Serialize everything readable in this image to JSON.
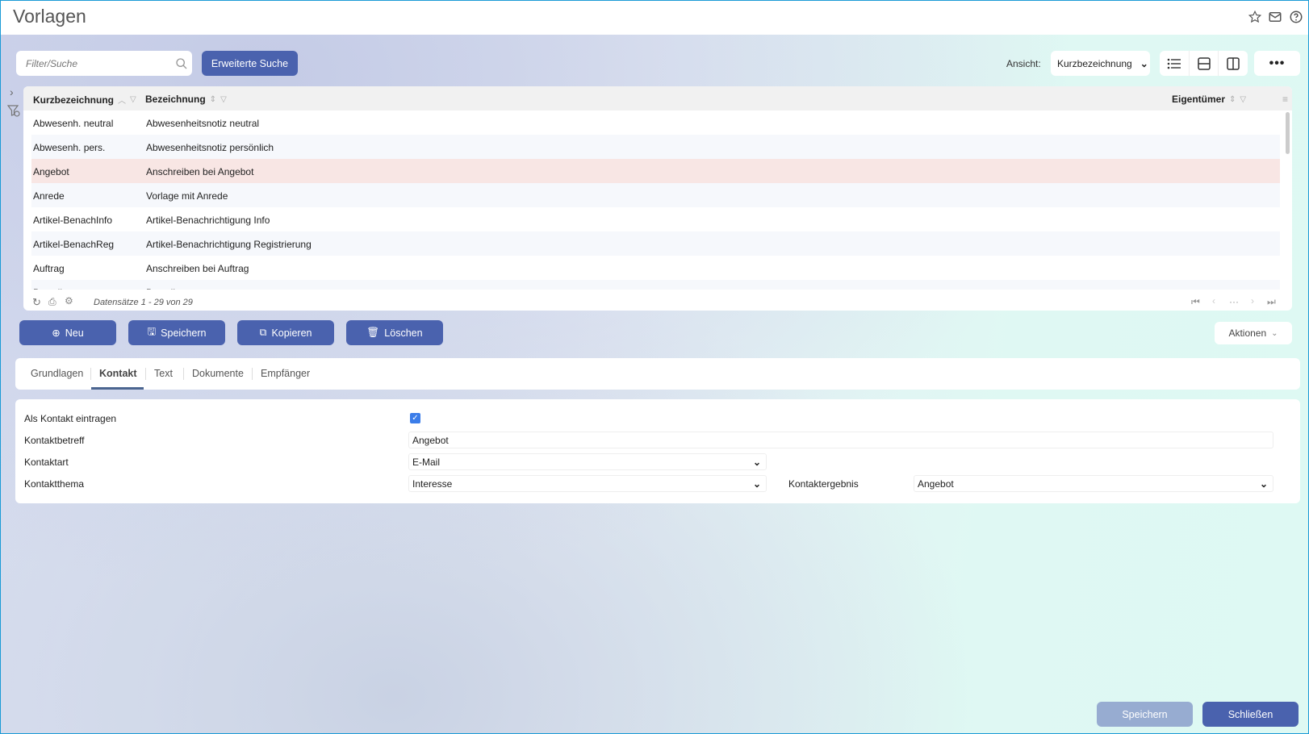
{
  "title": "Vorlagen",
  "header_icons": [
    "star-icon",
    "mail-icon",
    "help-icon"
  ],
  "toolbar": {
    "search_placeholder": "Filter/Suche",
    "advanced_search": "Erweiterte Suche",
    "view_label": "Ansicht:",
    "view_value": "Kurzbezeichnung",
    "more": "•••"
  },
  "grid": {
    "columns": [
      "Kurzbezeichnung",
      "Bezeichnung",
      "Eigentümer"
    ],
    "rows": [
      [
        "Abwesenh. neutral",
        "Abwesenheitsnotiz neutral"
      ],
      [
        "Abwesenh. pers.",
        "Abwesenheitsnotiz persönlich"
      ],
      [
        "Angebot",
        "Anschreiben bei Angebot"
      ],
      [
        "Anrede",
        "Vorlage mit Anrede"
      ],
      [
        "Artikel-BenachInfo",
        "Artikel-Benachrichtigung Info"
      ],
      [
        "Artikel-BenachReg",
        "Artikel-Benachrichtigung Registrierung"
      ],
      [
        "Auftrag",
        "Anschreiben bei Auftrag"
      ],
      [
        "Bestellung",
        "Bestellung"
      ]
    ],
    "selected_row": 2,
    "records": "Datensätze 1 - 29 von 29",
    "pager": {
      "ellipsis": "···"
    }
  },
  "actions": {
    "new": "Neu",
    "save": "Speichern",
    "copy": "Kopieren",
    "delete": "Löschen",
    "more": "Aktionen"
  },
  "tabs": [
    "Grundlagen",
    "Kontakt",
    "Text",
    "Dokumente",
    "Empfänger"
  ],
  "active_tab": "Kontakt",
  "form": {
    "als_kontakt_label": "Als Kontakt eintragen",
    "als_kontakt_checked": true,
    "betreff_label": "Kontaktbetreff",
    "betreff_value": "Angebot",
    "art_label": "Kontaktart",
    "art_value": "E-Mail",
    "thema_label": "Kontaktthema",
    "thema_value": "Interesse",
    "ergebnis_label": "Kontaktergebnis",
    "ergebnis_value": "Angebot"
  },
  "footer": {
    "save": "Speichern",
    "close": "Schließen"
  },
  "colors": {
    "primary": "#4a62ae",
    "disabled": "#97acd1",
    "selected_row": "#f8e6e4",
    "checkbox": "#3b7de9"
  }
}
